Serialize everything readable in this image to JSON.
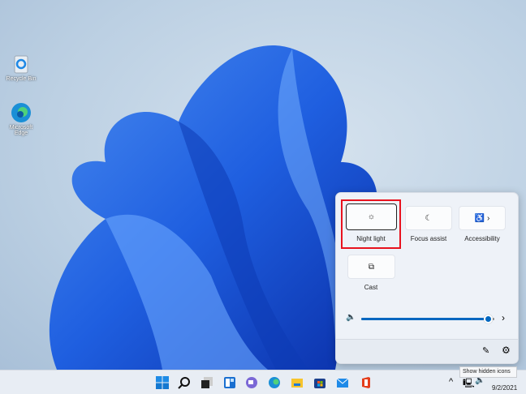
{
  "desktop": {
    "icons": [
      {
        "label": "Recycle Bin",
        "icon": "recycle-bin-icon"
      },
      {
        "label": "Microsoft Edge",
        "icon": "edge-icon"
      }
    ]
  },
  "quick_settings": {
    "tiles": [
      {
        "label": "Night light",
        "icon": "sun-icon",
        "highlighted": true
      },
      {
        "label": "Focus assist",
        "icon": "moon-icon"
      },
      {
        "label": "Accessibility",
        "icon": "accessibility-icon",
        "chevron": "›"
      },
      {
        "label": "Cast",
        "icon": "cast-icon"
      }
    ],
    "volume": {
      "level_percent": 96,
      "chevron": "›"
    },
    "footer": {
      "edit": "pencil-icon",
      "settings": "gear-icon"
    }
  },
  "taskbar": {
    "apps": [
      "start-icon",
      "search-icon",
      "task-view-icon",
      "widgets-icon",
      "teams-chat-icon",
      "edge-icon",
      "file-explorer-icon",
      "store-icon",
      "mail-icon",
      "office-icon"
    ],
    "tray": {
      "chevron": "^",
      "date": "9/2/2021",
      "tooltip": "Show hidden icons"
    }
  },
  "colors": {
    "accent": "#0067c0",
    "highlight": "#e8121e"
  }
}
